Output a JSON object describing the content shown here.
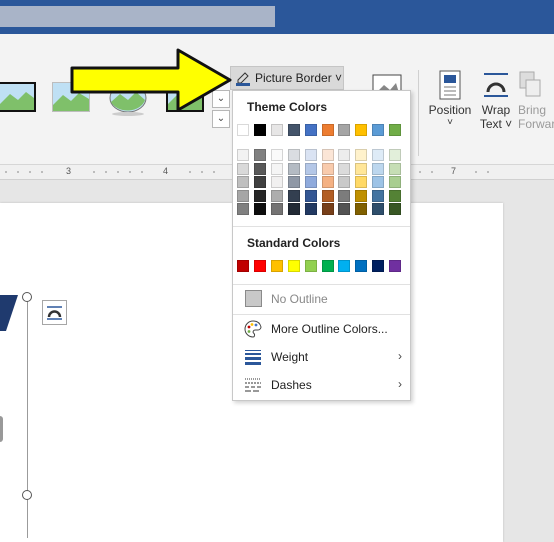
{
  "ribbon": {
    "picture_border_label": "Picture Border ˅",
    "position_label": "Position",
    "position_chevron": "˅",
    "wrap_label": "Wrap",
    "wrap_sub": "Text ˅",
    "bring_label": "Bring",
    "bring_sub": "Forward"
  },
  "ruler": {
    "ticks": [
      "3",
      "4",
      "7"
    ]
  },
  "dropdown": {
    "theme_header": "Theme Colors",
    "standard_header": "Standard Colors",
    "no_outline": "No Outline",
    "more_colors": "More Outline Colors...",
    "weight": "Weight",
    "dashes": "Dashes",
    "submenu_arrow": "›"
  },
  "colors": {
    "accent": "#2b579a",
    "arrow": "#ffff00",
    "theme_top": [
      "#ffffff",
      "#000000",
      "#e7e6e6",
      "#44546a",
      "#4472c4",
      "#ed7d31",
      "#a5a5a5",
      "#ffc000",
      "#5b9bd5",
      "#70ad47"
    ],
    "standard": [
      "#c00000",
      "#ff0000",
      "#ffc000",
      "#ffff00",
      "#92d050",
      "#00b050",
      "#00b0f0",
      "#0070c0",
      "#002060",
      "#7030a0"
    ]
  }
}
